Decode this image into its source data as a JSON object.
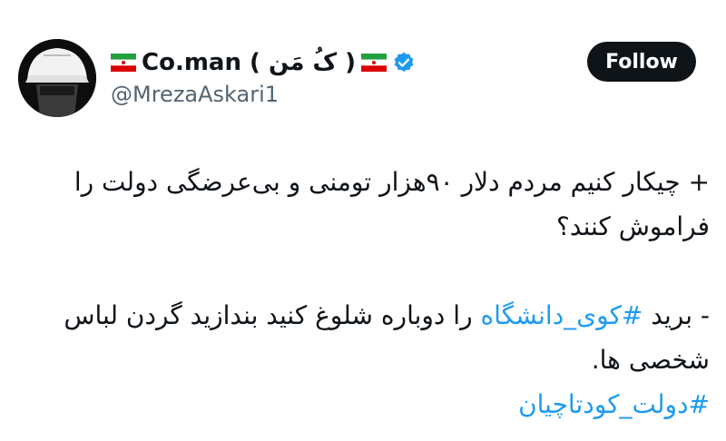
{
  "tweet": {
    "author": {
      "display_name": "Co.man ( کُ مَن )",
      "handle": "@MrezaAskari1",
      "verified": true,
      "flag_icon": "iran-flag-icon",
      "verified_color": "#1d9bf0"
    },
    "follow_label": "Follow",
    "body": {
      "paragraph1": "+ چیکار کنیم مردم دلار ۹۰هزار تومنی و بی‌عرضگی دولت را فراموش کنند؟",
      "p2_prefix": "- برید ",
      "p2_hashtag": "#کوی_دانشگاه",
      "p2_suffix": " را دوباره شلوغ کنید بندازید گردن لباس شخصی ها.",
      "hashtag2": "#دولت_کودتاچیان"
    },
    "colors": {
      "text": "#0f1419",
      "secondary": "#536471",
      "link": "#1d9bf0",
      "button_bg": "#0f1419"
    }
  }
}
